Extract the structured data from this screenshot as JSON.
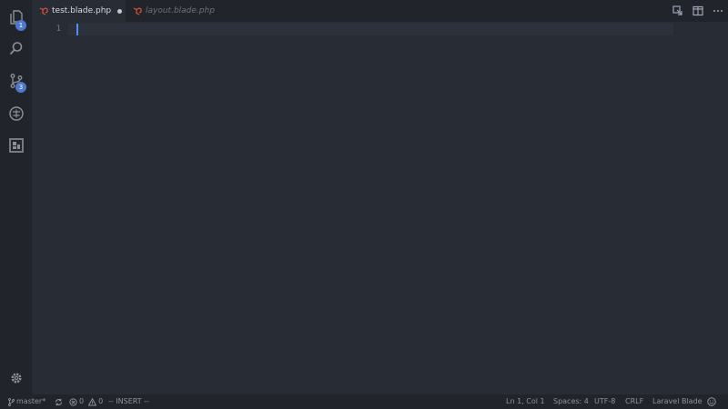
{
  "activity_bar": {
    "items": [
      {
        "name": "explorer",
        "badge": "1"
      },
      {
        "name": "search"
      },
      {
        "name": "source-control",
        "badge": "3"
      },
      {
        "name": "debug"
      },
      {
        "name": "extensions"
      }
    ],
    "settings": "gear-icon"
  },
  "tabs": [
    {
      "label": "test.blade.php",
      "active": true,
      "dirty": true,
      "icon": "laravel-icon"
    },
    {
      "label": "layout.blade.php",
      "active": false,
      "icon": "laravel-icon"
    }
  ],
  "tab_actions": [
    "open-changes-icon",
    "split-editor-icon",
    "more-icon"
  ],
  "editor": {
    "line_numbers": [
      "1"
    ]
  },
  "statusbar": {
    "branch": "master*",
    "errors": "0",
    "warnings": "0",
    "mode": "-- INSERT --",
    "position": "Ln 1, Col 1",
    "spaces": "Spaces: 4",
    "encoding": "UTF-8",
    "eol": "CRLF",
    "language": "Laravel Blade"
  },
  "colors": {
    "background": "#282c34",
    "sidebar": "#21252b",
    "accent": "#4d78cc",
    "laravel": "#e0513c"
  }
}
